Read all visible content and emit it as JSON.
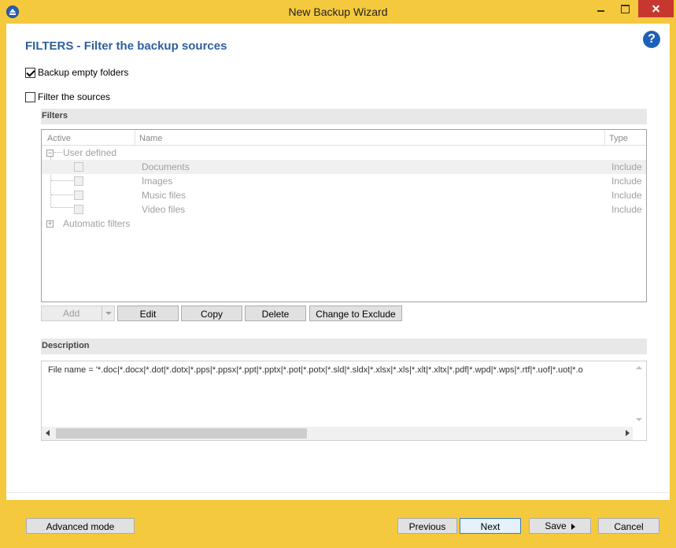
{
  "window": {
    "title": "New Backup Wizard"
  },
  "page": {
    "title": "FILTERS - Filter the backup sources",
    "help_label": "?"
  },
  "options": {
    "backup_empty_folders": {
      "label": "Backup empty folders",
      "checked": true
    },
    "filter_sources": {
      "label": "Filter the sources",
      "checked": false
    }
  },
  "filters": {
    "section_title": "Filters",
    "columns": {
      "active": "Active",
      "name": "Name",
      "type": "Type"
    },
    "groups": [
      {
        "label": "User defined",
        "expanded": true,
        "items": [
          {
            "name": "Documents",
            "type": "Include",
            "active": false,
            "selected": true
          },
          {
            "name": "Images",
            "type": "Include",
            "active": false
          },
          {
            "name": "Music files",
            "type": "Include",
            "active": false
          },
          {
            "name": "Video files",
            "type": "Include",
            "active": false
          }
        ]
      },
      {
        "label": "Automatic filters",
        "expanded": false
      }
    ],
    "buttons": {
      "add": "Add",
      "edit": "Edit",
      "copy": "Copy",
      "delete": "Delete",
      "change_to_exclude": "Change to Exclude"
    }
  },
  "description": {
    "section_title": "Description",
    "text": "File name =  '*.doc|*.docx|*.dot|*.dotx|*.pps|*.ppsx|*.ppt|*.pptx|*.pot|*.potx|*.sld|*.sldx|*.xlsx|*.xls|*.xlt|*.xltx|*.pdf|*.wpd|*.wps|*.rtf|*.uof|*.uot|*.o"
  },
  "footer": {
    "advanced_mode": "Advanced mode",
    "previous": "Previous",
    "next": "Next",
    "save": "Save",
    "cancel": "Cancel"
  },
  "colors": {
    "frame": "#f5c93d",
    "title_accent": "#2e5f9e",
    "close_button": "#c7372f",
    "help_icon": "#1f61b8"
  }
}
